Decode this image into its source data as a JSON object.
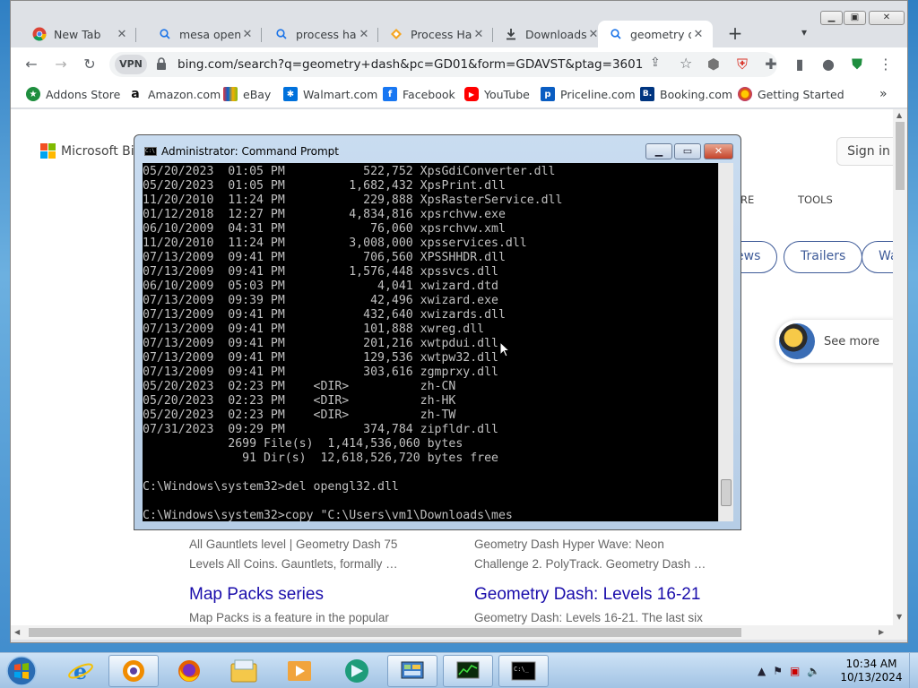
{
  "browser": {
    "tabs": [
      {
        "title": "New Tab",
        "icon": "chrome-icon"
      },
      {
        "title": "mesa openg",
        "icon": "search-icon"
      },
      {
        "title": "process hac",
        "icon": "search-icon"
      },
      {
        "title": "Process Ha",
        "icon": "process-hacker-icon"
      },
      {
        "title": "Downloads",
        "icon": "download-icon"
      },
      {
        "title": "geometry d",
        "icon": "search-icon"
      }
    ],
    "new_tab": "+",
    "close_glyph": "✕",
    "address": {
      "vpn_label": "VPN",
      "url": "bing.com/search?q=geometry+dash&pc=GD01&form=GDAVST&ptag=3601"
    },
    "bookmarks": [
      {
        "label": "Addons Store",
        "color": "#1e8e3e",
        "glyph": "★"
      },
      {
        "label": "Amazon.com",
        "color": "#111111",
        "glyph": "a"
      },
      {
        "label": "eBay",
        "color": "#e53238",
        "glyph": "e"
      },
      {
        "label": "Walmart.com",
        "color": "#0071dc",
        "glyph": "✱"
      },
      {
        "label": "Facebook",
        "color": "#1877f2",
        "glyph": "f"
      },
      {
        "label": "YouTube",
        "color": "#ff0000",
        "glyph": "▶"
      },
      {
        "label": "Priceline.com",
        "color": "#0a5dc2",
        "glyph": "p"
      },
      {
        "label": "Booking.com",
        "color": "#003580",
        "glyph": "B."
      },
      {
        "label": "Getting Started",
        "color": "#e66000",
        "glyph": "●"
      }
    ],
    "bookmarks_more": "»"
  },
  "bing": {
    "logo_text": "Microsoft Bing",
    "signin": "Sign in",
    "nav_more": "ORE",
    "nav_tools": "TOOLS",
    "pills": [
      "ews",
      "Trailers",
      "Wa"
    ],
    "see_more": "See more",
    "results": [
      {
        "snippet1": "All Gauntlets level | Geometry Dash 75",
        "snippet2": "Levels All Coins. Gauntlets, formally …"
      },
      {
        "snippet1": "Geometry Dash Hyper Wave: Neon",
        "snippet2": "Challenge 2. PolyTrack. Geometry Dash …"
      },
      {
        "title": "Map Packs series",
        "snippet1": "Map Packs is a feature in the popular"
      },
      {
        "title": "Geometry Dash: Levels 16-21",
        "snippet1": "Geometry Dash: Levels 16-21. The last six"
      }
    ]
  },
  "cmd": {
    "title": "Administrator: Command Prompt",
    "lines": [
      "05/20/2023  01:05 PM           522,752 XpsGdiConverter.dll",
      "05/20/2023  01:05 PM         1,682,432 XpsPrint.dll",
      "11/20/2010  11:24 PM           229,888 XpsRasterService.dll",
      "01/12/2018  12:27 PM         4,834,816 xpsrchvw.exe",
      "06/10/2009  04:31 PM            76,060 xpsrchvw.xml",
      "11/20/2010  11:24 PM         3,008,000 xpsservices.dll",
      "07/13/2009  09:41 PM           706,560 XPSSHHDR.dll",
      "07/13/2009  09:41 PM         1,576,448 xpssvcs.dll",
      "06/10/2009  05:03 PM             4,041 xwizard.dtd",
      "07/13/2009  09:39 PM            42,496 xwizard.exe",
      "07/13/2009  09:41 PM           432,640 xwizards.dll",
      "07/13/2009  09:41 PM           101,888 xwreg.dll",
      "07/13/2009  09:41 PM           201,216 xwtpdui.dll",
      "07/13/2009  09:41 PM           129,536 xwtpw32.dll",
      "07/13/2009  09:41 PM           303,616 zgmprxy.dll",
      "05/20/2023  02:23 PM    <DIR>          zh-CN",
      "05/20/2023  02:23 PM    <DIR>          zh-HK",
      "05/20/2023  02:23 PM    <DIR>          zh-TW",
      "07/31/2023  09:29 PM           374,784 zipfldr.dll",
      "            2699 File(s)  1,414,536,060 bytes",
      "              91 Dir(s)  12,618,526,720 bytes free",
      "",
      "C:\\Windows\\system32>del opengl32.dll",
      "",
      "C:\\Windows\\system32>copy \"C:\\Users\\vm1\\Downloads\\mes"
    ]
  },
  "taskbar": {
    "apps": [
      "ie-icon",
      "avast-browser-icon",
      "firefox-icon",
      "explorer-icon",
      "media-player-icon",
      "app-icon",
      "control-panel-icon",
      "task-manager-icon",
      "cmd-icon"
    ],
    "time": "10:34 AM",
    "date": "10/13/2024"
  }
}
